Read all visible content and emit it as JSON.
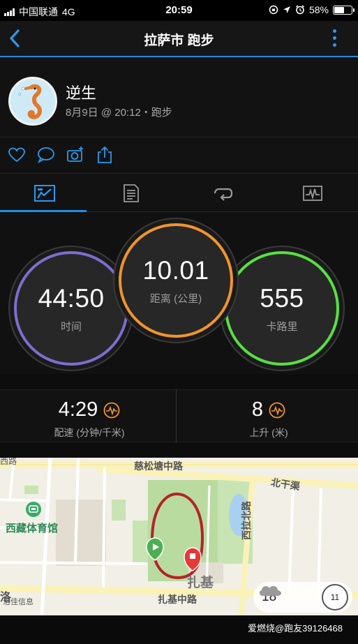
{
  "status_bar": {
    "carrier": "中国联通",
    "network": "4G",
    "time": "20:59",
    "battery": "58%",
    "battery_level": 0.58
  },
  "header": {
    "title": "拉萨市 跑步",
    "accent_color": "#1d8ee6"
  },
  "profile": {
    "username": "逆生",
    "subtitle": "8月9日 @ 20:12・跑步"
  },
  "actions": {
    "icons": [
      "heart-icon",
      "comment-icon",
      "camera-icon",
      "share-icon"
    ]
  },
  "tabs": {
    "active_index": 0,
    "icons": [
      "overview-chart-icon",
      "details-list-icon",
      "laps-loop-icon",
      "graph-icon"
    ]
  },
  "metrics": {
    "time": {
      "value": "44:50",
      "label": "时间",
      "color": "#7c6ed0"
    },
    "distance": {
      "value": "10.01",
      "label": "距离 (公里)",
      "color": "#f0952d"
    },
    "calories": {
      "value": "555",
      "label": "卡路里",
      "color": "#58e040"
    }
  },
  "stats": {
    "pace": {
      "value": "4:29",
      "label": "配速 (分钟/千米)"
    },
    "ascent": {
      "value": "8",
      "label": "上升 (米)"
    },
    "icon_color": "#f0952d"
  },
  "map": {
    "labels": {
      "road_top": "慈松塘中路",
      "road_right_top": "北干渠",
      "road_vertical": "西拉北路",
      "stadium": "西藏体育馆",
      "road_bottom": "扎基中路",
      "area": "扎基",
      "bottom_left": "洛",
      "poi_left": "洛佳信息",
      "left_top_edge": "西路"
    },
    "weather": {
      "temperature": "18°",
      "aqi": "11"
    }
  },
  "footer": {
    "watermark": "爱燃烧@跑友39126468"
  }
}
